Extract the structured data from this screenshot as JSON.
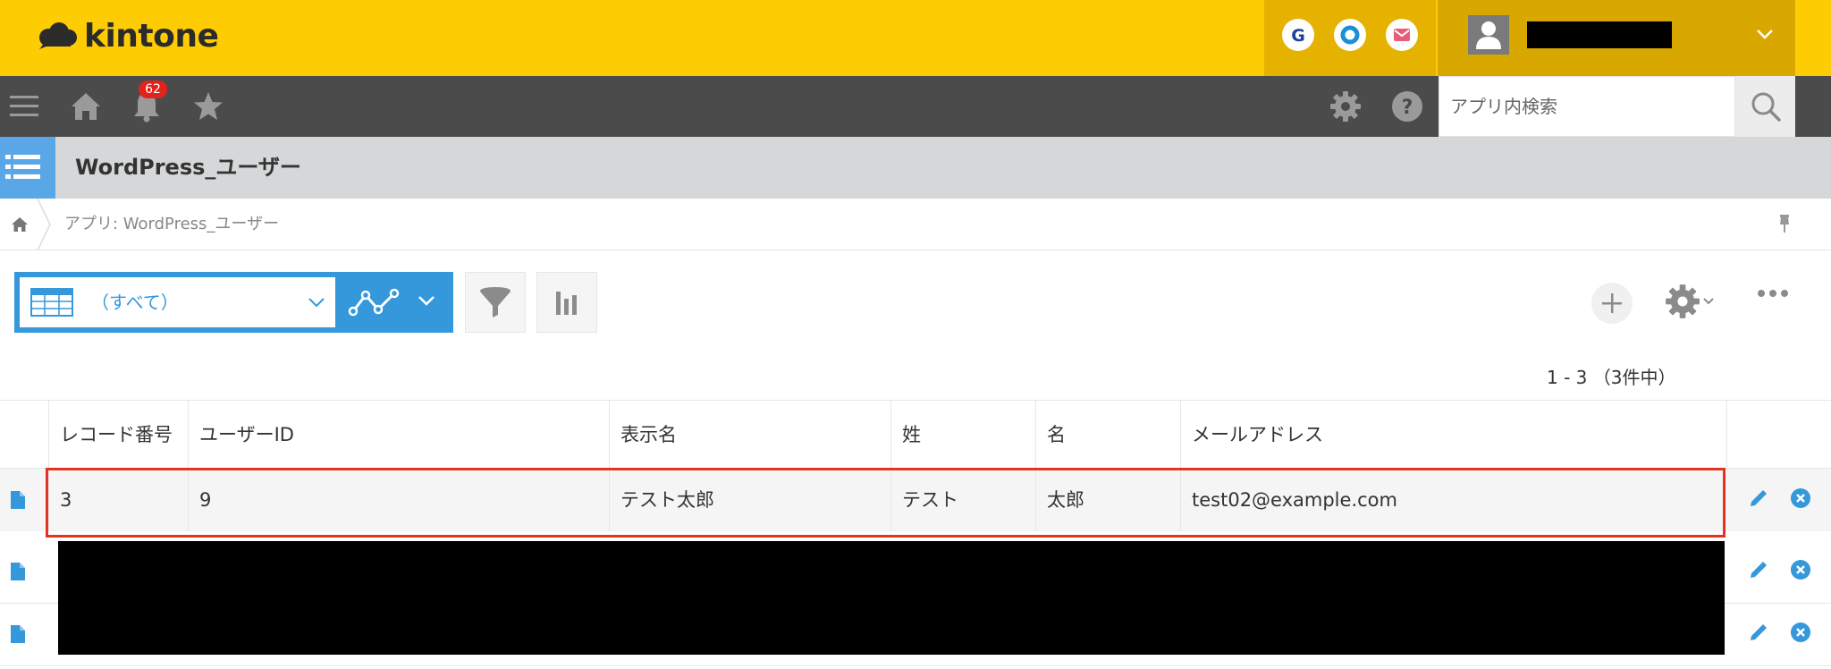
{
  "header": {
    "logo_text": "kintone",
    "services": [
      "G",
      "O",
      "M"
    ],
    "user_name": "",
    "brand_color": "#fecc02"
  },
  "nav": {
    "notification_count": "62",
    "search_placeholder": "アプリ内検索"
  },
  "app": {
    "title": "WordPress_ユーザー",
    "breadcrumb": "アプリ: WordPress_ユーザー"
  },
  "toolbar": {
    "view_label": "（すべて）",
    "accent_color": "#3498db"
  },
  "pager": {
    "text": "1 - 3 （3件中）"
  },
  "table": {
    "columns": [
      "レコード番号",
      "ユーザーID",
      "表示名",
      "姓",
      "名",
      "メールアドレス"
    ],
    "rows": [
      [
        "3",
        "9",
        "テスト太郎",
        "テスト",
        "太郎",
        "test02@example.com"
      ],
      [
        "",
        "",
        "",
        "",
        "",
        ""
      ],
      [
        "",
        "",
        "",
        "",
        "",
        ""
      ]
    ]
  }
}
